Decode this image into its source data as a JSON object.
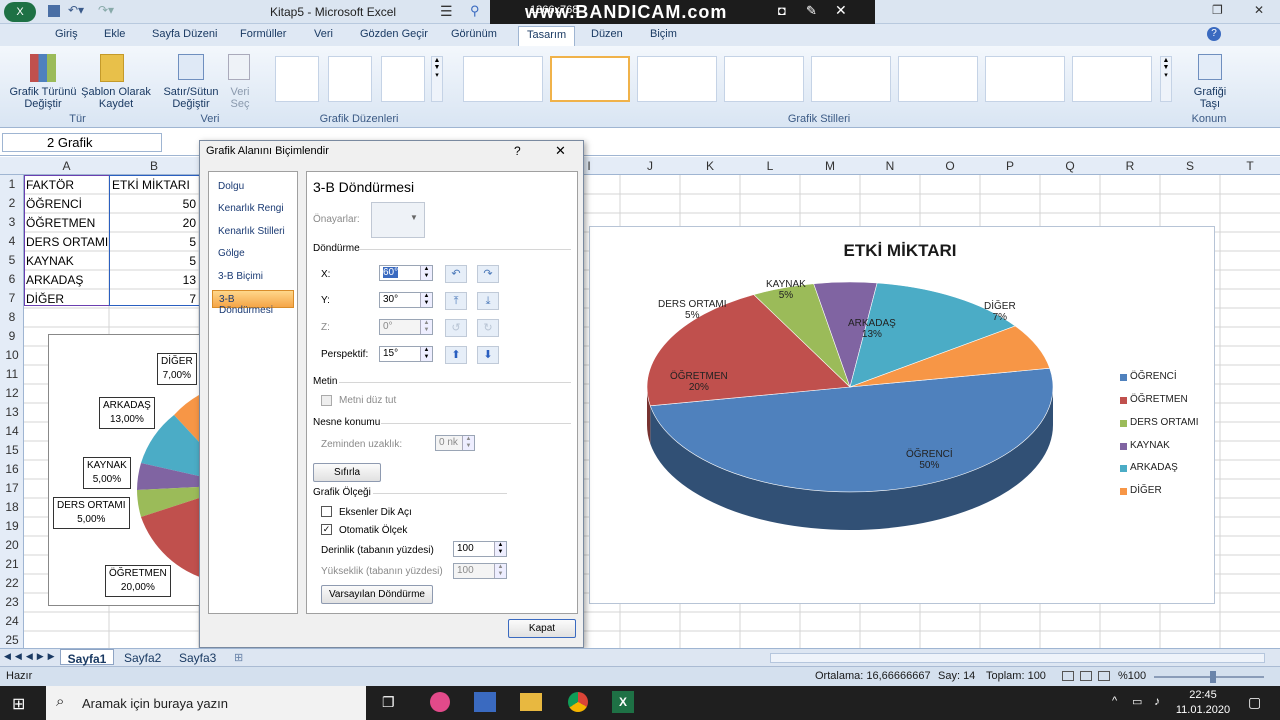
{
  "app": {
    "title": "Kitap5 - Microsoft Excel"
  },
  "recorder": {
    "size": "1366x768",
    "logo": "www.BANDICAM.com"
  },
  "ribbon_tabs": [
    "Giriş",
    "Ekle",
    "Sayfa Düzeni",
    "Formüller",
    "Veri",
    "Gözden Geçir",
    "Görünüm",
    "Tasarım",
    "Düzen",
    "Biçim"
  ],
  "ribbon": {
    "change_type": "Grafik Türünü Değiştir",
    "save_template": "Şablon Olarak Kaydet",
    "group_type": "Tür",
    "switch_rowcol": "Satır/Sütun Değiştir",
    "select_data": "Veri Seç",
    "group_data": "Veri",
    "group_layouts": "Grafik Düzenleri",
    "group_styles": "Grafik Stilleri",
    "move_chart": "Grafiği Taşı",
    "group_location": "Konum"
  },
  "namebox": "2 Grafik",
  "columns_left": [
    "A",
    "B"
  ],
  "columns_right": [
    "I",
    "J",
    "K",
    "L",
    "M",
    "N",
    "O",
    "P",
    "Q",
    "R",
    "S",
    "T"
  ],
  "rows": [
    "1",
    "2",
    "3",
    "4",
    "5",
    "6",
    "7",
    "8",
    "9",
    "10",
    "11",
    "12",
    "13",
    "14",
    "15",
    "16",
    "17",
    "18",
    "19",
    "20",
    "21",
    "22",
    "23",
    "24",
    "25"
  ],
  "table": {
    "header": [
      "FAKTÖR",
      "ETKİ MİKTARI"
    ],
    "rows": [
      [
        "ÖĞRENCİ",
        "50"
      ],
      [
        "ÖĞRETMEN",
        "20"
      ],
      [
        "DERS ORTAMI",
        "5"
      ],
      [
        "KAYNAK",
        "5"
      ],
      [
        "ARKADAŞ",
        "13"
      ],
      [
        "DİĞER",
        "7"
      ]
    ]
  },
  "dialog": {
    "title": "Grafik Alanını Biçimlendir",
    "help": "?",
    "close": "✕",
    "menu": [
      "Dolgu",
      "Kenarlık Rengi",
      "Kenarlık Stilleri",
      "Gölge",
      "3-B Biçimi",
      "3-B Döndürmesi"
    ],
    "heading": "3-B Döndürmesi",
    "presets": "Önayarlar:",
    "rotation": "Döndürme",
    "x_label": "X:",
    "x_value": "60°",
    "y_label": "Y:",
    "y_value": "30°",
    "z_label": "Z:",
    "z_value": "0°",
    "persp_label": "Perspektif:",
    "persp_value": "15°",
    "text_section": "Metin",
    "keep_flat": "Metni düz tut",
    "object_pos": "Nesne konumu",
    "distance_label": "Zeminden uzaklık:",
    "distance_value": "0 nk",
    "reset": "Sıfırla",
    "chart_scale": "Grafik Ölçeği",
    "right_angle": "Eksenler Dik Açı",
    "autoscale": "Otomatik Ölçek",
    "depth_label": "Derinlik (tabanın yüzdesi)",
    "depth_value": "100",
    "height_label": "Yükseklik (tabanın yüzdesi)",
    "height_value": "100",
    "default_rot": "Varsayılan Döndürme",
    "close_btn": "Kapat"
  },
  "chart_data": {
    "type": "pie",
    "title": "ETKİ MİKTARI",
    "categories": [
      "ÖĞRENCİ",
      "ÖĞRETMEN",
      "DERS ORTAMI",
      "KAYNAK",
      "ARKADAŞ",
      "DİĞER"
    ],
    "values": [
      50,
      20,
      5,
      5,
      13,
      7
    ],
    "percent_labels": [
      "50%",
      "20%",
      "5%",
      "5%",
      "13%",
      "7%"
    ],
    "colors": [
      "#4f81bd",
      "#c0504d",
      "#9bbb59",
      "#8064a2",
      "#4bacc6",
      "#f79646"
    ],
    "legend": "right",
    "three_d": true
  },
  "chart2": {
    "labels": [
      [
        "DİĞER",
        "7,00%"
      ],
      [
        "ARKADAŞ",
        "13,00%"
      ],
      [
        "KAYNAK",
        "5,00%"
      ],
      [
        "DERS ORTAMI",
        "5,00%"
      ],
      [
        "ÖĞRETMEN",
        "20,00%"
      ]
    ]
  },
  "sheets": [
    "Sayfa1",
    "Sayfa2",
    "Sayfa3"
  ],
  "status": {
    "ready": "Hazır",
    "average": "Ortalama: 16,66666667",
    "count": "Say: 14",
    "sum": "Toplam: 100",
    "zoom": "%100"
  },
  "taskbar": {
    "search": "Aramak için buraya yazın",
    "time": "22:45",
    "date": "11.01.2020"
  }
}
